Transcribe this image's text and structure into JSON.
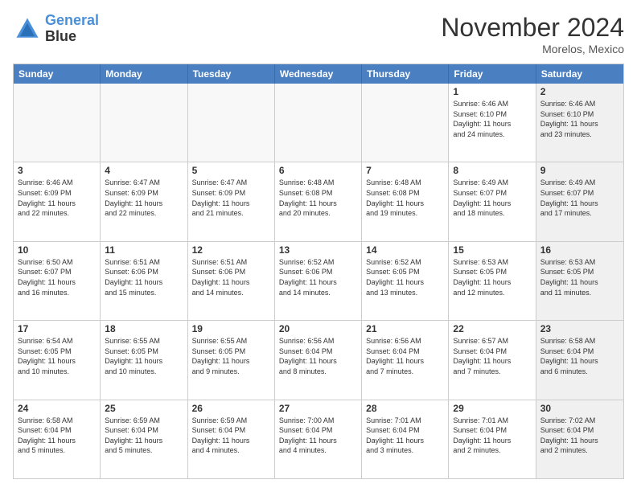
{
  "logo": {
    "line1": "General",
    "line2": "Blue"
  },
  "title": "November 2024",
  "subtitle": "Morelos, Mexico",
  "header_days": [
    "Sunday",
    "Monday",
    "Tuesday",
    "Wednesday",
    "Thursday",
    "Friday",
    "Saturday"
  ],
  "rows": [
    [
      {
        "day": "",
        "info": "",
        "empty": true
      },
      {
        "day": "",
        "info": "",
        "empty": true
      },
      {
        "day": "",
        "info": "",
        "empty": true
      },
      {
        "day": "",
        "info": "",
        "empty": true
      },
      {
        "day": "",
        "info": "",
        "empty": true
      },
      {
        "day": "1",
        "info": "Sunrise: 6:46 AM\nSunset: 6:10 PM\nDaylight: 11 hours\nand 24 minutes.",
        "shaded": false
      },
      {
        "day": "2",
        "info": "Sunrise: 6:46 AM\nSunset: 6:10 PM\nDaylight: 11 hours\nand 23 minutes.",
        "shaded": true
      }
    ],
    [
      {
        "day": "3",
        "info": "Sunrise: 6:46 AM\nSunset: 6:09 PM\nDaylight: 11 hours\nand 22 minutes.",
        "shaded": false
      },
      {
        "day": "4",
        "info": "Sunrise: 6:47 AM\nSunset: 6:09 PM\nDaylight: 11 hours\nand 22 minutes.",
        "shaded": false
      },
      {
        "day": "5",
        "info": "Sunrise: 6:47 AM\nSunset: 6:09 PM\nDaylight: 11 hours\nand 21 minutes.",
        "shaded": false
      },
      {
        "day": "6",
        "info": "Sunrise: 6:48 AM\nSunset: 6:08 PM\nDaylight: 11 hours\nand 20 minutes.",
        "shaded": false
      },
      {
        "day": "7",
        "info": "Sunrise: 6:48 AM\nSunset: 6:08 PM\nDaylight: 11 hours\nand 19 minutes.",
        "shaded": false
      },
      {
        "day": "8",
        "info": "Sunrise: 6:49 AM\nSunset: 6:07 PM\nDaylight: 11 hours\nand 18 minutes.",
        "shaded": false
      },
      {
        "day": "9",
        "info": "Sunrise: 6:49 AM\nSunset: 6:07 PM\nDaylight: 11 hours\nand 17 minutes.",
        "shaded": true
      }
    ],
    [
      {
        "day": "10",
        "info": "Sunrise: 6:50 AM\nSunset: 6:07 PM\nDaylight: 11 hours\nand 16 minutes.",
        "shaded": false
      },
      {
        "day": "11",
        "info": "Sunrise: 6:51 AM\nSunset: 6:06 PM\nDaylight: 11 hours\nand 15 minutes.",
        "shaded": false
      },
      {
        "day": "12",
        "info": "Sunrise: 6:51 AM\nSunset: 6:06 PM\nDaylight: 11 hours\nand 14 minutes.",
        "shaded": false
      },
      {
        "day": "13",
        "info": "Sunrise: 6:52 AM\nSunset: 6:06 PM\nDaylight: 11 hours\nand 14 minutes.",
        "shaded": false
      },
      {
        "day": "14",
        "info": "Sunrise: 6:52 AM\nSunset: 6:05 PM\nDaylight: 11 hours\nand 13 minutes.",
        "shaded": false
      },
      {
        "day": "15",
        "info": "Sunrise: 6:53 AM\nSunset: 6:05 PM\nDaylight: 11 hours\nand 12 minutes.",
        "shaded": false
      },
      {
        "day": "16",
        "info": "Sunrise: 6:53 AM\nSunset: 6:05 PM\nDaylight: 11 hours\nand 11 minutes.",
        "shaded": true
      }
    ],
    [
      {
        "day": "17",
        "info": "Sunrise: 6:54 AM\nSunset: 6:05 PM\nDaylight: 11 hours\nand 10 minutes.",
        "shaded": false
      },
      {
        "day": "18",
        "info": "Sunrise: 6:55 AM\nSunset: 6:05 PM\nDaylight: 11 hours\nand 10 minutes.",
        "shaded": false
      },
      {
        "day": "19",
        "info": "Sunrise: 6:55 AM\nSunset: 6:05 PM\nDaylight: 11 hours\nand 9 minutes.",
        "shaded": false
      },
      {
        "day": "20",
        "info": "Sunrise: 6:56 AM\nSunset: 6:04 PM\nDaylight: 11 hours\nand 8 minutes.",
        "shaded": false
      },
      {
        "day": "21",
        "info": "Sunrise: 6:56 AM\nSunset: 6:04 PM\nDaylight: 11 hours\nand 7 minutes.",
        "shaded": false
      },
      {
        "day": "22",
        "info": "Sunrise: 6:57 AM\nSunset: 6:04 PM\nDaylight: 11 hours\nand 7 minutes.",
        "shaded": false
      },
      {
        "day": "23",
        "info": "Sunrise: 6:58 AM\nSunset: 6:04 PM\nDaylight: 11 hours\nand 6 minutes.",
        "shaded": true
      }
    ],
    [
      {
        "day": "24",
        "info": "Sunrise: 6:58 AM\nSunset: 6:04 PM\nDaylight: 11 hours\nand 5 minutes.",
        "shaded": false
      },
      {
        "day": "25",
        "info": "Sunrise: 6:59 AM\nSunset: 6:04 PM\nDaylight: 11 hours\nand 5 minutes.",
        "shaded": false
      },
      {
        "day": "26",
        "info": "Sunrise: 6:59 AM\nSunset: 6:04 PM\nDaylight: 11 hours\nand 4 minutes.",
        "shaded": false
      },
      {
        "day": "27",
        "info": "Sunrise: 7:00 AM\nSunset: 6:04 PM\nDaylight: 11 hours\nand 4 minutes.",
        "shaded": false
      },
      {
        "day": "28",
        "info": "Sunrise: 7:01 AM\nSunset: 6:04 PM\nDaylight: 11 hours\nand 3 minutes.",
        "shaded": false
      },
      {
        "day": "29",
        "info": "Sunrise: 7:01 AM\nSunset: 6:04 PM\nDaylight: 11 hours\nand 2 minutes.",
        "shaded": false
      },
      {
        "day": "30",
        "info": "Sunrise: 7:02 AM\nSunset: 6:04 PM\nDaylight: 11 hours\nand 2 minutes.",
        "shaded": true
      }
    ]
  ]
}
